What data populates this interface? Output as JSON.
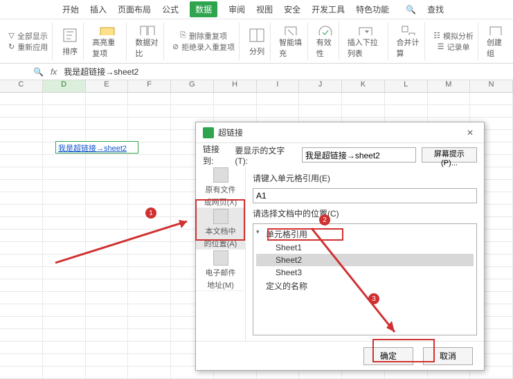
{
  "menu": {
    "items": [
      "开始",
      "插入",
      "页面布局",
      "公式",
      "数据",
      "审阅",
      "视图",
      "安全",
      "开发工具",
      "特色功能",
      "查找"
    ],
    "activeIndex": 4
  },
  "ribbon": {
    "g1a": "全部显示",
    "g1b": "重新应用",
    "g1c": "排序",
    "g2": "高亮重复项",
    "g3": "数据对比",
    "g4a": "删除重复项",
    "g4b": "拒绝录入重复项",
    "g5": "分列",
    "g6": "智能填充",
    "g7": "有效性",
    "g8": "插入下拉列表",
    "g9": "合并计算",
    "g10a": "模拟分析",
    "g10b": "记录单",
    "g11": "创建组"
  },
  "formula": {
    "fx": "fx",
    "value": "我是超链接→sheet2"
  },
  "cols": [
    "C",
    "D",
    "E",
    "F",
    "G",
    "H",
    "I",
    "J",
    "K",
    "L",
    "M",
    "N"
  ],
  "selCol": "D",
  "linkcell": "我是超链接→sheet2",
  "dialog": {
    "title": "超链接",
    "linkToLabel": "链接到:",
    "displayLabel": "要显示的文字(T):",
    "displayValue": "我是超链接→sheet2",
    "tipBtn": "屏幕提示(P)...",
    "side": {
      "item1a": "原有文件",
      "item1b": "或网页(X)",
      "item2a": "本文档中",
      "item2b": "的位置(A)",
      "item3a": "电子邮件",
      "item3b": "地址(M)"
    },
    "refLabel": "请键入单元格引用(E)",
    "refValue": "A1",
    "treeLabel": "请选择文档中的位置(C)",
    "tree": {
      "root": "单元格引用",
      "s1": "Sheet1",
      "s2": "Sheet2",
      "s3": "Sheet3",
      "defn": "定义的名称"
    },
    "ok": "确定",
    "cancel": "取消"
  },
  "badges": {
    "b1": "1",
    "b2": "2",
    "b3": "3"
  }
}
